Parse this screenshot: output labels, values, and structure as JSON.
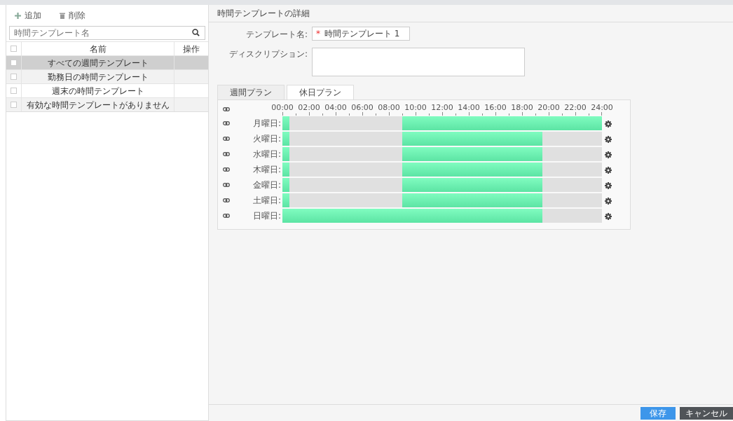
{
  "toolbar": {
    "add_label": "追加",
    "delete_label": "削除"
  },
  "search": {
    "placeholder": "時間テンプレート名"
  },
  "template_table": {
    "select_all_checked": false,
    "columns": [
      "名前",
      "操作"
    ],
    "rows": [
      {
        "name": "すべての週間テンプレート",
        "selected": true,
        "checked": false
      },
      {
        "name": "勤務日の時間テンプレート",
        "selected": false,
        "checked": false
      },
      {
        "name": "週末の時間テンプレート",
        "selected": false,
        "checked": false
      },
      {
        "name": "有効な時間テンプレートがありません",
        "selected": false,
        "checked": false
      }
    ]
  },
  "detail": {
    "title": "時間テンプレートの詳細",
    "name_label": "テンプレート名:",
    "required_mark": "*",
    "name_value": "時間テンプレート 1",
    "description_label": "ディスクリプション:",
    "tabs": [
      {
        "label": "週間プラン",
        "selected": false
      },
      {
        "label": "休日プラン",
        "selected": true
      }
    ],
    "hour_labels": [
      "00:00",
      "02:00",
      "04:00",
      "06:00",
      "08:00",
      "10:00",
      "12:00",
      "14:00",
      "16:00",
      "18:00",
      "20:00",
      "22:00",
      "24:00"
    ],
    "days": [
      {
        "label": "月曜日:",
        "slots": [
          true,
          false,
          false,
          false,
          false,
          false,
          false,
          false,
          false,
          false,
          false,
          false,
          false,
          false,
          false,
          false,
          false,
          false,
          true,
          true,
          true,
          true,
          true,
          true,
          true,
          true,
          true,
          true,
          true,
          true,
          true,
          true,
          true,
          true,
          true,
          true,
          true,
          true,
          true,
          true,
          true,
          true,
          true,
          true,
          true,
          true,
          true,
          true
        ]
      },
      {
        "label": "火曜日:",
        "slots": [
          true,
          false,
          false,
          false,
          false,
          false,
          false,
          false,
          false,
          false,
          false,
          false,
          false,
          false,
          false,
          false,
          false,
          false,
          true,
          true,
          true,
          true,
          true,
          true,
          true,
          true,
          true,
          true,
          true,
          true,
          true,
          true,
          true,
          true,
          true,
          true,
          true,
          true,
          true,
          false,
          false,
          false,
          false,
          false,
          false,
          false,
          false,
          false
        ]
      },
      {
        "label": "水曜日:",
        "slots": [
          true,
          false,
          false,
          false,
          false,
          false,
          false,
          false,
          false,
          false,
          false,
          false,
          false,
          false,
          false,
          false,
          false,
          false,
          true,
          true,
          true,
          true,
          true,
          true,
          true,
          true,
          true,
          true,
          true,
          true,
          true,
          true,
          true,
          true,
          true,
          true,
          true,
          true,
          true,
          false,
          false,
          false,
          false,
          false,
          false,
          false,
          false,
          false
        ]
      },
      {
        "label": "木曜日:",
        "slots": [
          true,
          false,
          false,
          false,
          false,
          false,
          false,
          false,
          false,
          false,
          false,
          false,
          false,
          false,
          false,
          false,
          false,
          false,
          true,
          true,
          true,
          true,
          true,
          true,
          true,
          true,
          true,
          true,
          true,
          true,
          true,
          true,
          true,
          true,
          true,
          true,
          true,
          true,
          true,
          false,
          false,
          false,
          false,
          false,
          false,
          false,
          false,
          false
        ]
      },
      {
        "label": "金曜日:",
        "slots": [
          true,
          false,
          false,
          false,
          false,
          false,
          false,
          false,
          false,
          false,
          false,
          false,
          false,
          false,
          false,
          false,
          false,
          false,
          true,
          true,
          true,
          true,
          true,
          true,
          true,
          true,
          true,
          true,
          true,
          true,
          true,
          true,
          true,
          true,
          true,
          true,
          true,
          true,
          true,
          false,
          false,
          false,
          false,
          false,
          false,
          false,
          false,
          false
        ]
      },
      {
        "label": "土曜日:",
        "slots": [
          true,
          false,
          false,
          false,
          false,
          false,
          false,
          false,
          false,
          false,
          false,
          false,
          false,
          false,
          false,
          false,
          false,
          false,
          true,
          true,
          true,
          true,
          true,
          true,
          true,
          true,
          true,
          true,
          true,
          true,
          true,
          true,
          true,
          true,
          true,
          true,
          true,
          true,
          true,
          false,
          false,
          false,
          false,
          false,
          false,
          false,
          false,
          false
        ]
      },
      {
        "label": "日曜日:",
        "slots": [
          true,
          true,
          true,
          true,
          true,
          true,
          true,
          true,
          true,
          true,
          true,
          true,
          true,
          true,
          true,
          true,
          true,
          true,
          true,
          true,
          true,
          true,
          true,
          true,
          true,
          true,
          true,
          true,
          true,
          true,
          true,
          true,
          true,
          true,
          true,
          true,
          true,
          true,
          true,
          false,
          false,
          false,
          false,
          false,
          false,
          false,
          false,
          false
        ]
      }
    ]
  },
  "footer": {
    "buttons": [
      {
        "label": "保存",
        "kind": "primary"
      },
      {
        "label": "キャンセル",
        "kind": "secondary"
      }
    ]
  }
}
